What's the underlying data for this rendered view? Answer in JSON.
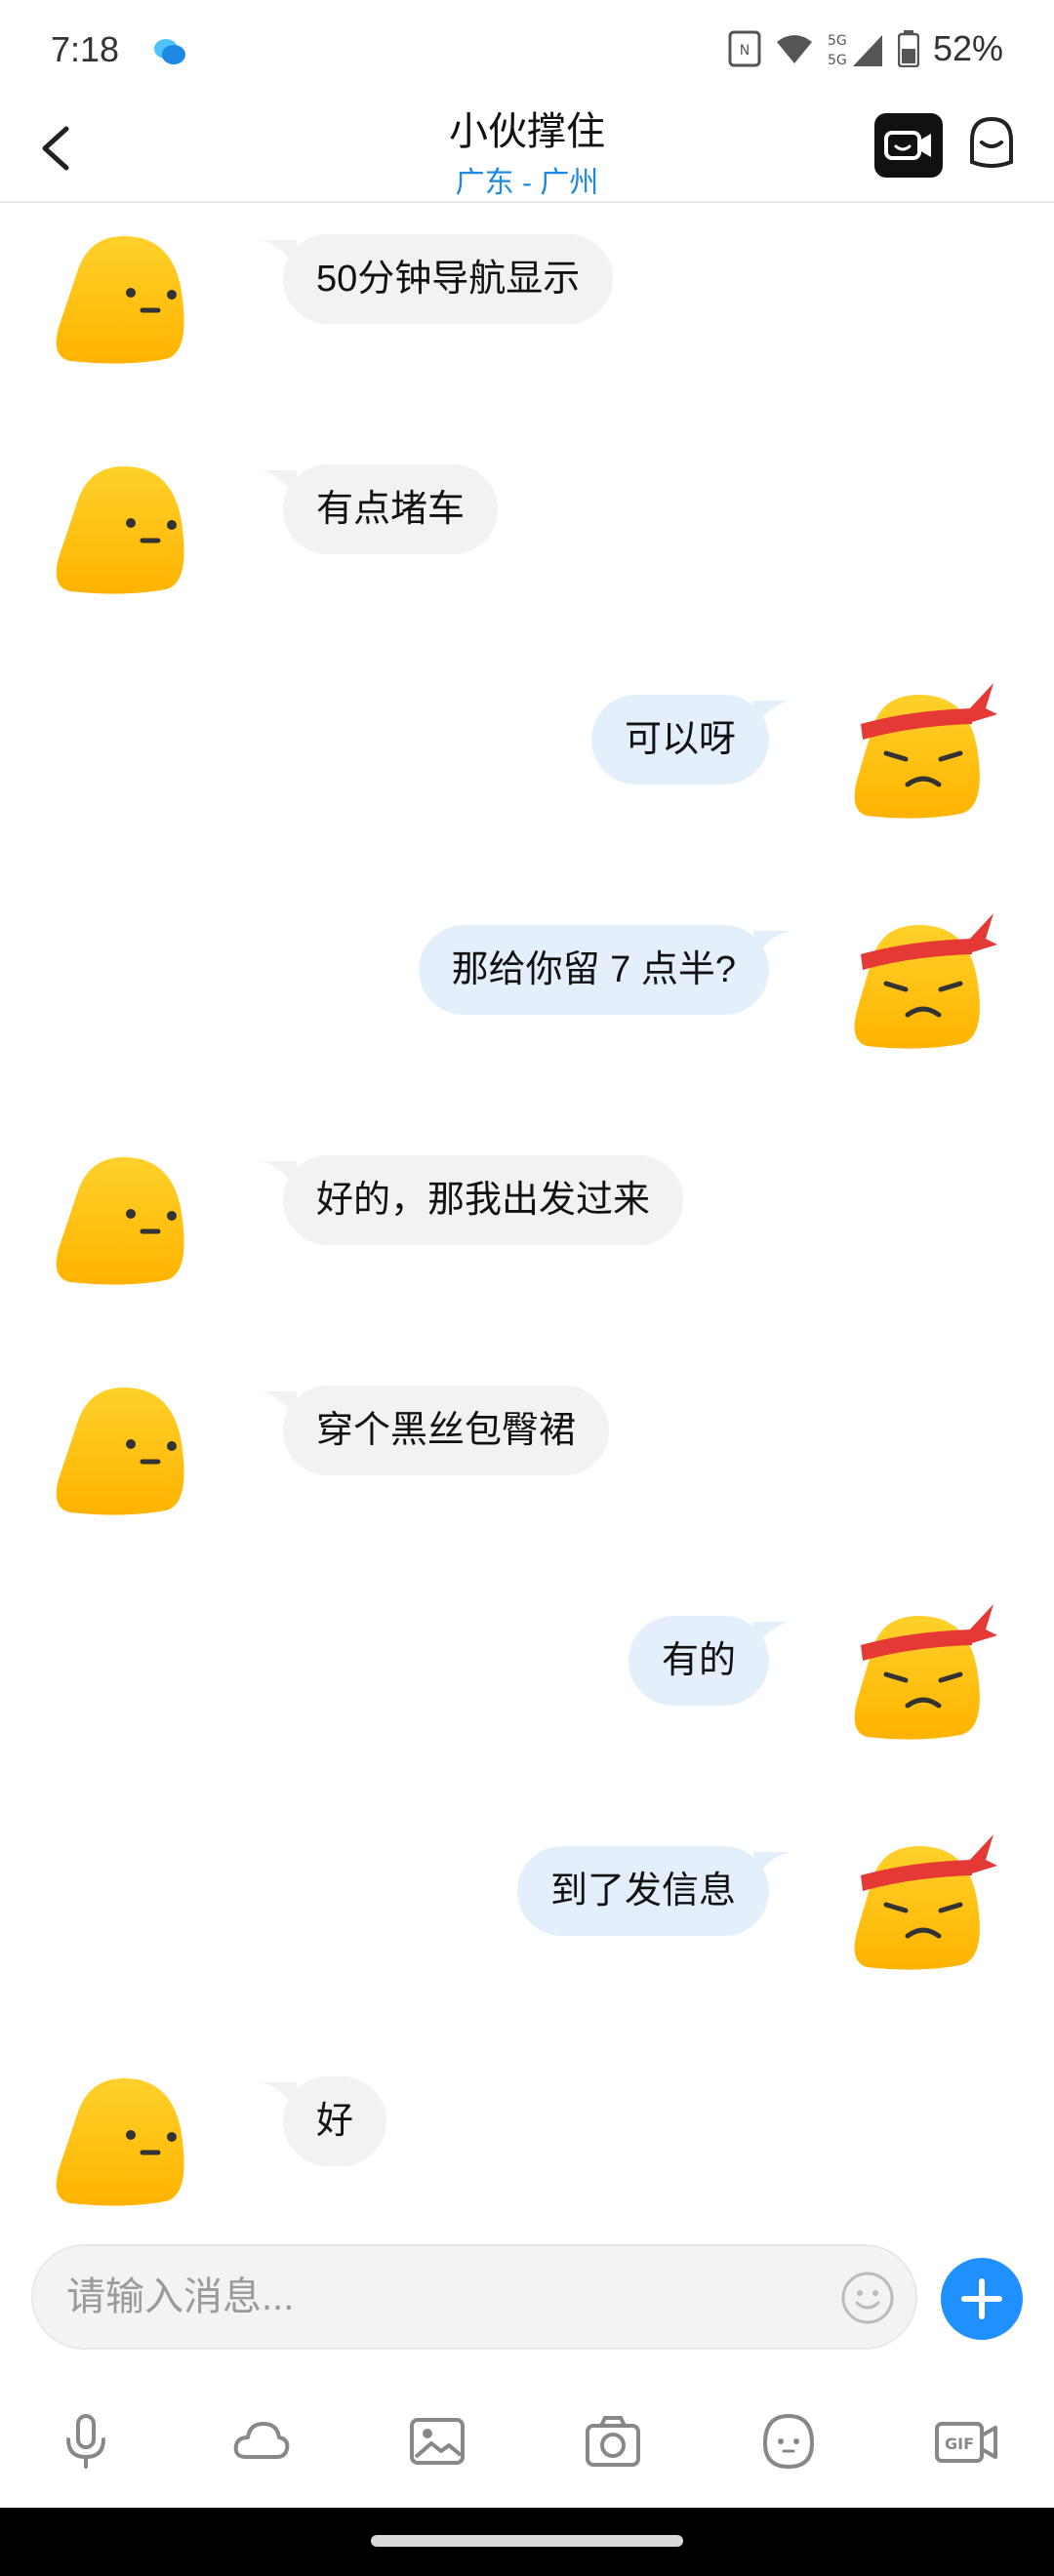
{
  "status_bar": {
    "time": "7:18",
    "battery": "52%",
    "icons": [
      "chat-notification-icon",
      "nfc-icon",
      "wifi-icon",
      "signal-5g-icon",
      "battery-icon"
    ]
  },
  "header": {
    "title": "小伙撑住",
    "subtitle": "广东 - 广州",
    "icons": [
      "back-icon",
      "video-call-icon",
      "profile-icon"
    ]
  },
  "messages": [
    {
      "side": "in",
      "text": "50分钟导航显示"
    },
    {
      "side": "in",
      "text": "有点堵车"
    },
    {
      "side": "out",
      "text": "可以呀"
    },
    {
      "side": "out",
      "text": "那给你留 7 点半?"
    },
    {
      "side": "in",
      "text": "好的，那我出发过来"
    },
    {
      "side": "in",
      "text": "穿个黑丝包臀裙"
    },
    {
      "side": "out",
      "text": "有的"
    },
    {
      "side": "out",
      "text": "到了发信息"
    },
    {
      "side": "in",
      "text": "好"
    }
  ],
  "input": {
    "placeholder": "请输入消息..."
  },
  "toolbar": [
    "mic-icon",
    "cloud-icon",
    "image-icon",
    "camera-icon",
    "sticker-icon",
    "gif-icon"
  ],
  "colors": {
    "accent": "#1e90ff",
    "incoming_bubble": "#f2f2f2",
    "outgoing_bubble": "#e3f0fb",
    "avatar_yellow": "#ffc21a",
    "headband_red": "#e53935"
  }
}
